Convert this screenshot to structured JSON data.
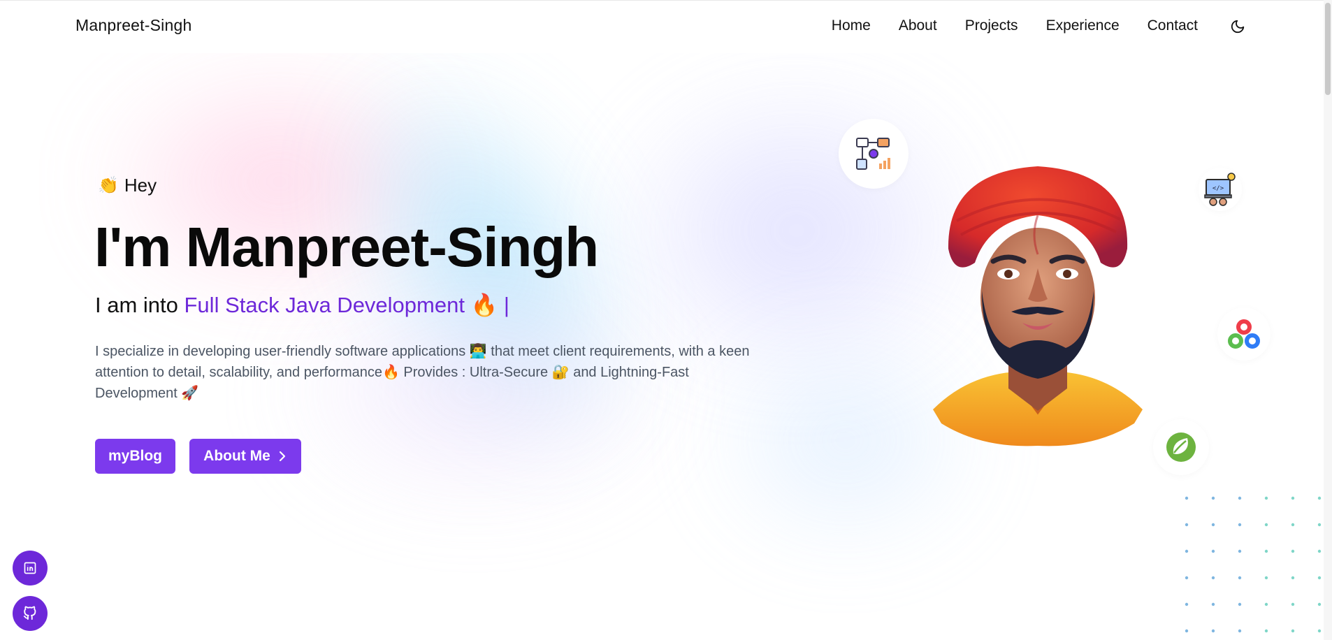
{
  "nav": {
    "brand": "Manpreet-Singh",
    "links": [
      "Home",
      "About",
      "Projects",
      "Experience",
      "Contact"
    ],
    "theme_icon": "moon-icon"
  },
  "hero": {
    "greeting_emoji": "👏",
    "greeting": "Hey",
    "title": "I'm Manpreet-Singh",
    "into_prefix": "I am into ",
    "into_highlight": "Full Stack Java Development",
    "into_emoji": "🔥",
    "into_cursor": "|",
    "description": "I specialize in developing user-friendly software applications 👨‍💻 that meet client requirements, with a keen attention to detail, scalability, and performance🔥 Provides : Ultra-Secure 🔐 and Lightning-Fast Development 🚀",
    "buttons": {
      "blog": "myBlog",
      "about": "About Me"
    }
  },
  "colors": {
    "accent": "#7c3aed",
    "accent_dark": "#6d28d9",
    "turban": "#e8352a",
    "beard": "#1e2238",
    "skin": "#c97a5c",
    "shirt": "#f6b12a"
  },
  "icons": {
    "floating": [
      "workflow-icon",
      "developer-laptop-icon",
      "opencv-icon",
      "spring-leaf-icon"
    ],
    "social": [
      "linkedin-icon",
      "github-icon"
    ]
  }
}
